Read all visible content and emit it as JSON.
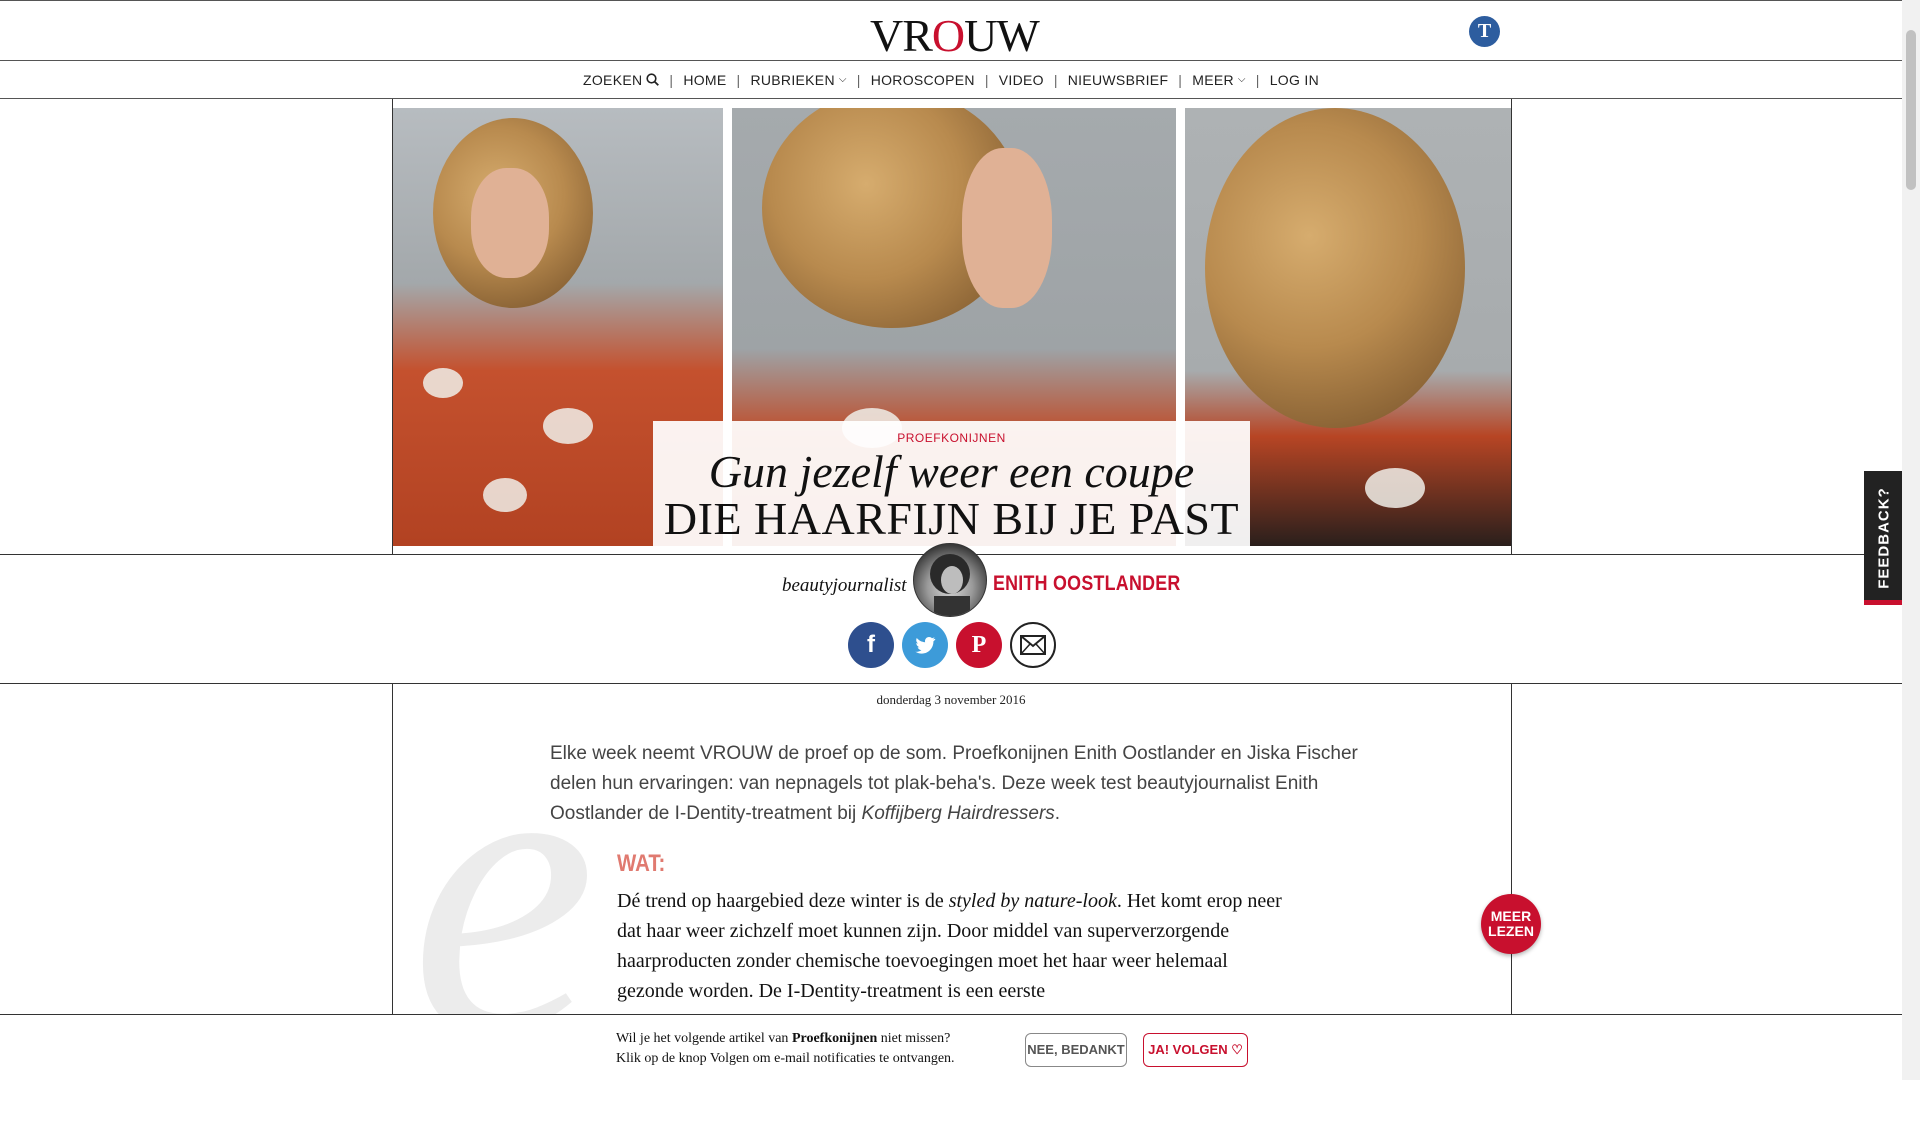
{
  "header": {
    "logo_left": "VR",
    "logo_o": "O",
    "logo_right": "UW",
    "partner_logo": "T"
  },
  "nav": {
    "items": [
      {
        "label": "ZOEKEN",
        "icon": "search-icon"
      },
      {
        "label": "HOME"
      },
      {
        "label": "RUBRIEKEN",
        "icon": "chevron-down-icon"
      },
      {
        "label": "HOROSCOPEN"
      },
      {
        "label": "VIDEO"
      },
      {
        "label": "NIEUWSBRIEF"
      },
      {
        "label": "MEER",
        "icon": "chevron-down-icon"
      },
      {
        "label": "LOG IN"
      }
    ],
    "separator": "|"
  },
  "hero": {
    "kicker": "PROEFKONIJNEN",
    "title_line1": "Gun jezelf weer een coupe",
    "title_line2": "DIE HAARFIJN BIJ JE PAST"
  },
  "author": {
    "role": "beautyjournalist",
    "name": "ENITH OOSTLANDER"
  },
  "social": {
    "facebook": "f",
    "twitter": "t",
    "pinterest": "P",
    "email": "✉"
  },
  "article": {
    "date": "donderdag 3 november 2016",
    "drop_letter": "e",
    "intro_a": "Elke week neemt VROUW de proef op de som. Proefkonijnen Enith Oostlander en Jiska Fischer delen hun ervaringen: van nepnagels tot plak-beha's. Deze week test beautyjournalist Enith Oostlander de I-Dentity-treatment bij ",
    "intro_italic": "Koffijberg Hairdressers",
    "intro_end": ".",
    "section_heading": "WAT:",
    "body_a": "Dé trend op haargebied deze winter is de ",
    "body_italic": "styled by nature-look",
    "body_b": ". Het komt erop neer dat haar weer zichzelf moet kunnen zijn. Door middel van superverzorgende haarproducten zonder chemische toevoegingen moet het haar weer helemaal  gezonde worden. De I-Dentity-treatment is een eerste"
  },
  "feedback_tab": "FEEDBACK?",
  "meer_lezen": {
    "line1": "MEER",
    "line2": "LEZEN"
  },
  "follow": {
    "text_line1_a": "Wil je het volgende artikel van ",
    "text_line1_bold": "Proefkonijnen",
    "text_line1_b": " niet missen?",
    "text_line2": "Klik op de knop Volgen om e-mail notificaties te ontvangen.",
    "no_label": "NEE, BEDANKT",
    "yes_label": "JA! VOLGEN ♡"
  },
  "colors": {
    "accent": "#c8102e",
    "facebook": "#2e4f8e",
    "twitter": "#3d9bd9"
  }
}
